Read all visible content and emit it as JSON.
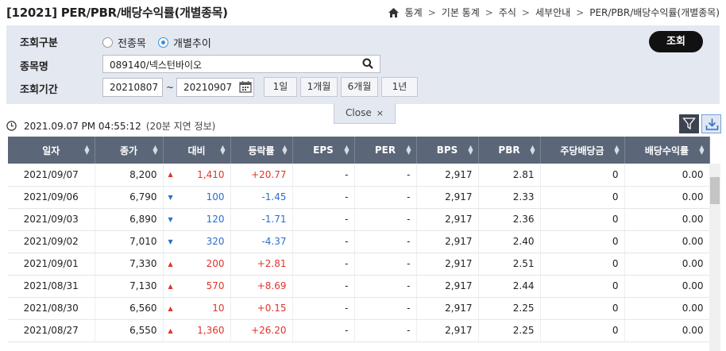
{
  "header": {
    "title": "[12021] PER/PBR/배당수익률(개별종목)",
    "breadcrumb": [
      "통계",
      "기본 통계",
      "주식",
      "세부안내",
      "PER/PBR/배당수익률(개별종목)"
    ]
  },
  "search": {
    "type_label": "조회구분",
    "type_options": [
      {
        "label": "전종목",
        "selected": false
      },
      {
        "label": "개별추이",
        "selected": true
      }
    ],
    "stock_label": "종목명",
    "stock_value": "089140/넥스턴바이오",
    "period_label": "조회기간",
    "start_date": "20210807",
    "tilde": "~",
    "end_date": "20210907",
    "period_buttons": [
      "1일",
      "1개월",
      "6개월",
      "1년"
    ],
    "search_button": "조회",
    "close_label": "Close",
    "close_icon": "×"
  },
  "status": {
    "timestamp": "2021.09.07 PM 04:55:12",
    "note": "(20분 지연 정보)"
  },
  "table": {
    "columns": [
      "일자",
      "종가",
      "대비",
      "등락률",
      "EPS",
      "PER",
      "BPS",
      "PBR",
      "주당배당금",
      "배당수익률"
    ],
    "rows": [
      {
        "date": "2021/09/07",
        "close": "8,200",
        "dir": "up",
        "change": "1,410",
        "rate": "+20.77",
        "eps": "-",
        "per": "-",
        "bps": "2,917",
        "pbr": "2.81",
        "dps": "0",
        "yield": "0.00"
      },
      {
        "date": "2021/09/06",
        "close": "6,790",
        "dir": "down",
        "change": "100",
        "rate": "-1.45",
        "eps": "-",
        "per": "-",
        "bps": "2,917",
        "pbr": "2.33",
        "dps": "0",
        "yield": "0.00"
      },
      {
        "date": "2021/09/03",
        "close": "6,890",
        "dir": "down",
        "change": "120",
        "rate": "-1.71",
        "eps": "-",
        "per": "-",
        "bps": "2,917",
        "pbr": "2.36",
        "dps": "0",
        "yield": "0.00"
      },
      {
        "date": "2021/09/02",
        "close": "7,010",
        "dir": "down",
        "change": "320",
        "rate": "-4.37",
        "eps": "-",
        "per": "-",
        "bps": "2,917",
        "pbr": "2.40",
        "dps": "0",
        "yield": "0.00"
      },
      {
        "date": "2021/09/01",
        "close": "7,330",
        "dir": "up",
        "change": "200",
        "rate": "+2.81",
        "eps": "-",
        "per": "-",
        "bps": "2,917",
        "pbr": "2.51",
        "dps": "0",
        "yield": "0.00"
      },
      {
        "date": "2021/08/31",
        "close": "7,130",
        "dir": "up",
        "change": "570",
        "rate": "+8.69",
        "eps": "-",
        "per": "-",
        "bps": "2,917",
        "pbr": "2.44",
        "dps": "0",
        "yield": "0.00"
      },
      {
        "date": "2021/08/30",
        "close": "6,560",
        "dir": "up",
        "change": "10",
        "rate": "+0.15",
        "eps": "-",
        "per": "-",
        "bps": "2,917",
        "pbr": "2.25",
        "dps": "0",
        "yield": "0.00"
      },
      {
        "date": "2021/08/27",
        "close": "6,550",
        "dir": "up",
        "change": "1,360",
        "rate": "+26.20",
        "eps": "-",
        "per": "-",
        "bps": "2,917",
        "pbr": "2.25",
        "dps": "0",
        "yield": "0.00"
      }
    ]
  },
  "colors": {
    "up": "#e0342b",
    "down": "#2a6fd0",
    "header_bg": "#5b6678",
    "panel_bg": "#e4e8f1"
  },
  "icons": {
    "home": "home-icon",
    "search": "search-icon",
    "calendar": "calendar-icon",
    "clock": "clock-icon",
    "filter": "filter-icon",
    "download": "download-icon"
  }
}
